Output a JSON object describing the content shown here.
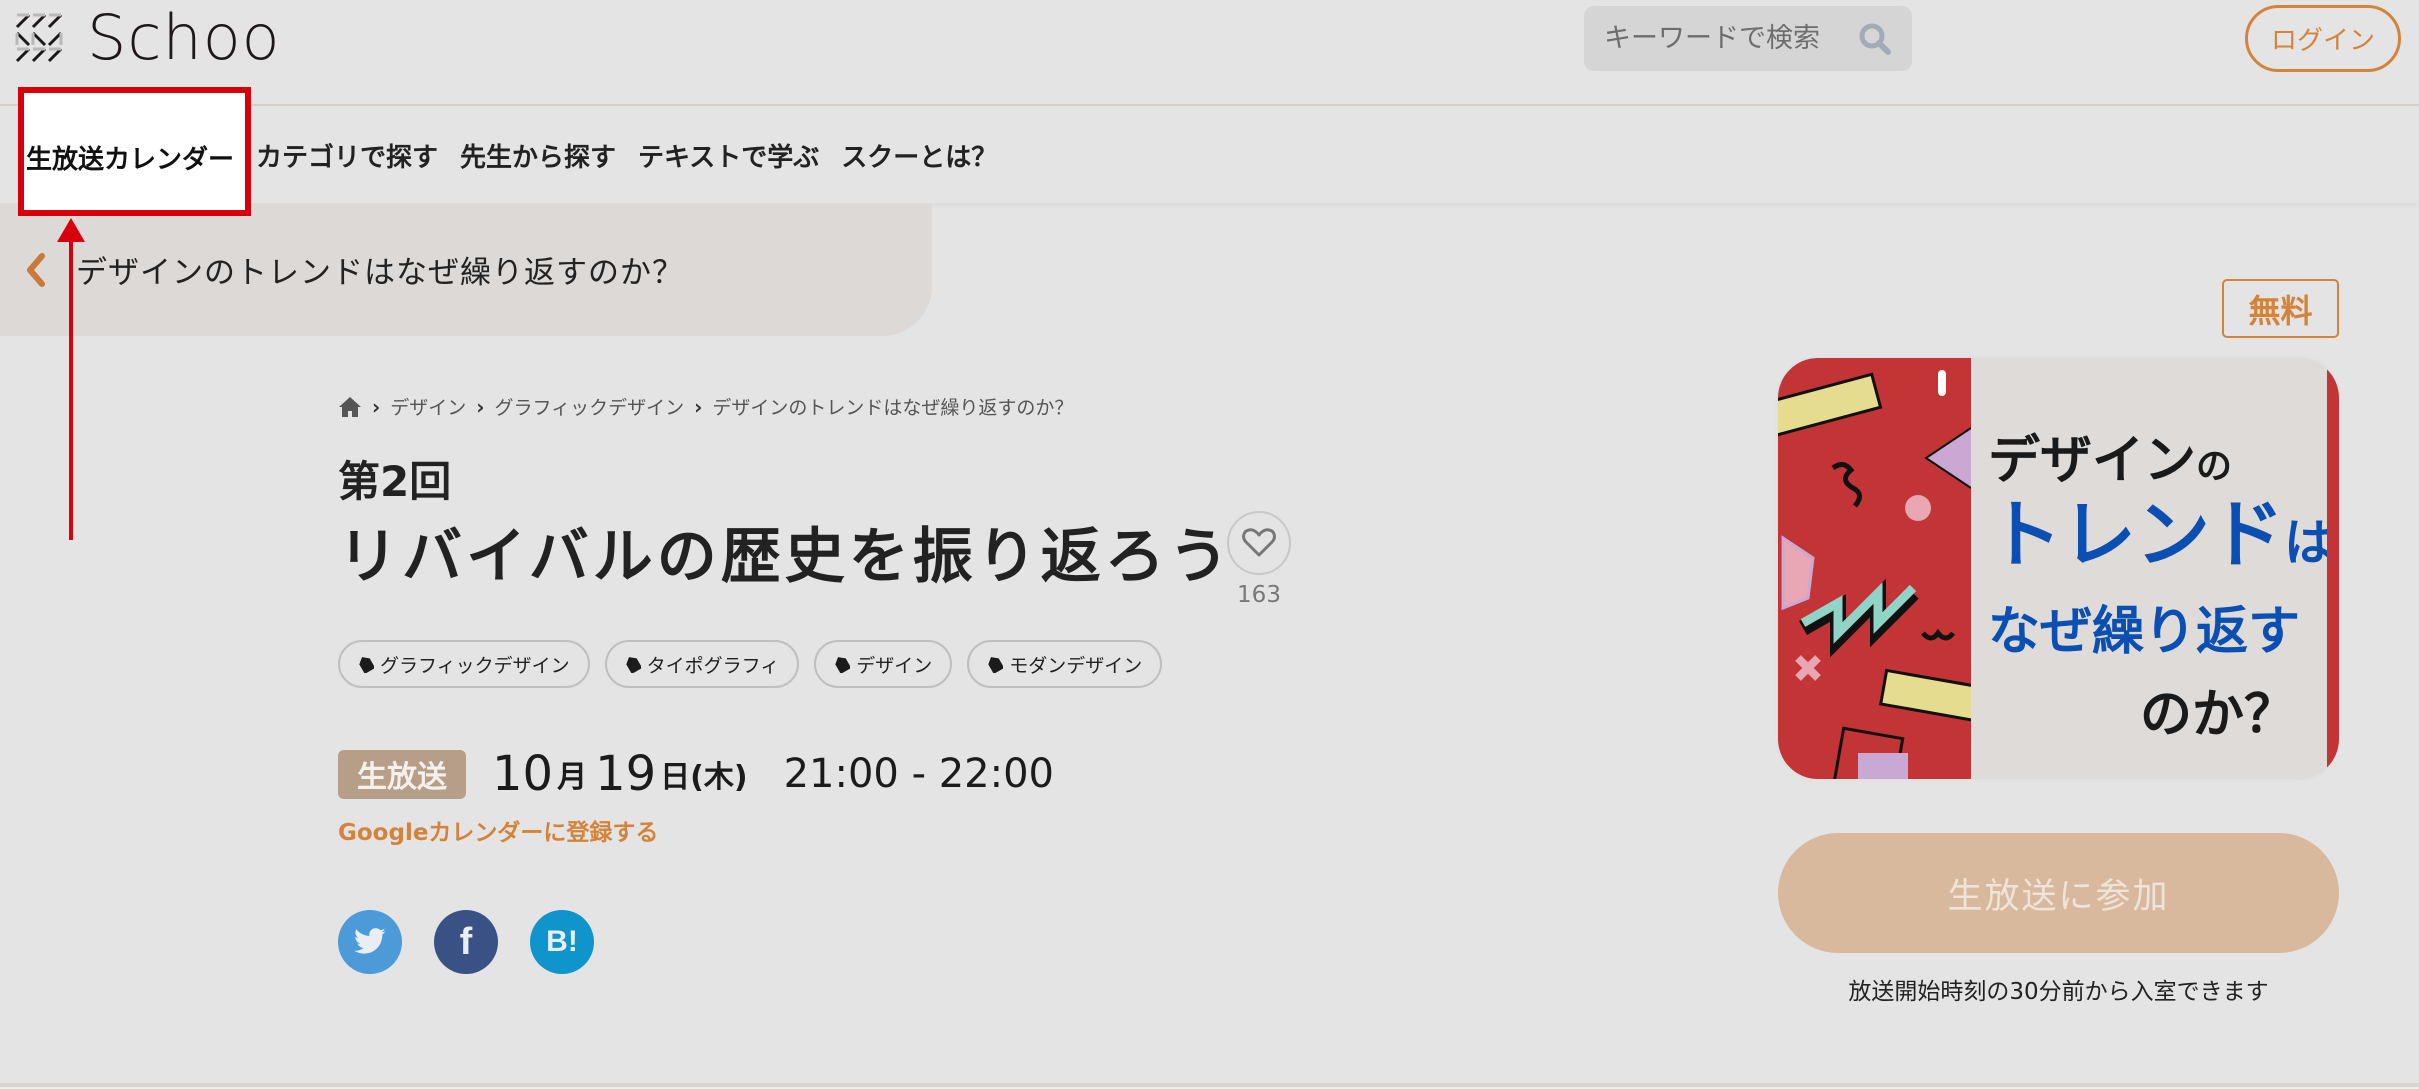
{
  "header": {
    "logo_text": "Schoo",
    "search_placeholder": "キーワードで検索",
    "search_value": "",
    "login_label": "ログイン"
  },
  "nav": {
    "items": [
      {
        "label": "生放送カレンダー",
        "highlighted": true
      },
      {
        "label": "カテゴリで探す"
      },
      {
        "label": "先生から探す"
      },
      {
        "label": "テキストで学ぶ"
      },
      {
        "label": "スクーとは？"
      }
    ]
  },
  "back_banner": {
    "title": "デザインのトレンドはなぜ繰り返すのか？"
  },
  "breadcrumb": {
    "items": [
      "デザイン",
      "グラフィックデザイン",
      "デザインのトレンドはなぜ繰り返すのか？"
    ]
  },
  "lesson": {
    "episode": "第2回",
    "title": "リバイバルの歴史を振り返ろう",
    "favorite_count": "163",
    "tags": [
      "グラフィックデザイン",
      "タイポグラフィ",
      "デザイン",
      "モダンデザイン"
    ],
    "live_badge": "生放送",
    "month": "10",
    "month_unit": "月",
    "day": "19",
    "day_unit": "日(木)",
    "time": "21:00 - 22:00",
    "gcal_link": "Googleカレンダーに登録する"
  },
  "social": {
    "twitter": "twitter",
    "facebook": "f",
    "hatena": "B!"
  },
  "sidebar": {
    "free_badge": "無料",
    "thumbnail": {
      "line1_main": "デザイン",
      "line1_small": "の",
      "line2_main": "トレンド",
      "line2_small": "は",
      "line3": "なぜ繰り返す",
      "line4": "のか？"
    },
    "join_button": "生放送に参加",
    "join_note": "放送開始時刻の30分前から入室できます"
  },
  "colors": {
    "accent_orange": "#d3843a",
    "annotation_red": "#d9000d",
    "live_badge": "#b69e89",
    "join_button": "#d9b99d",
    "twitter": "#4d9ad9",
    "facebook": "#3a5185",
    "hatena": "#0f94cc"
  }
}
